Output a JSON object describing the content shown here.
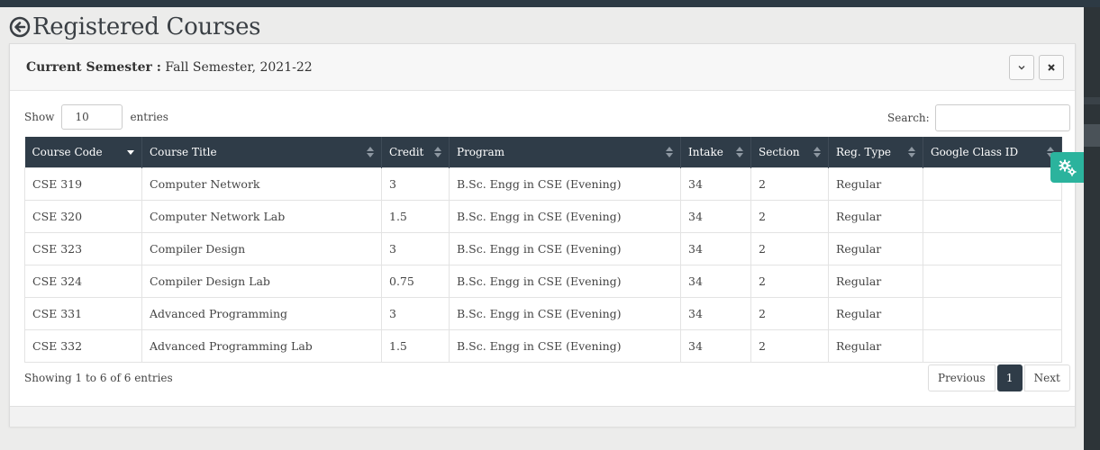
{
  "page": {
    "title": "Registered Courses"
  },
  "panel": {
    "semester_label": "Current Semester :",
    "semester_value": " Fall Semester, 2021-22"
  },
  "controls": {
    "show_label": "Show",
    "page_length": "10",
    "entries_label": "entries",
    "search_label": "Search:",
    "search_value": ""
  },
  "table": {
    "headers": [
      "Course Code",
      "Course Title",
      "Credit",
      "Program",
      "Intake",
      "Section",
      "Reg. Type",
      "Google Class ID"
    ],
    "rows": [
      [
        "CSE 319",
        "Computer Network",
        "3",
        "B.Sc. Engg in CSE (Evening)",
        "34",
        "2",
        "Regular",
        ""
      ],
      [
        "CSE 320",
        "Computer Network Lab",
        "1.5",
        "B.Sc. Engg in CSE (Evening)",
        "34",
        "2",
        "Regular",
        ""
      ],
      [
        "CSE 323",
        "Compiler Design",
        "3",
        "B.Sc. Engg in CSE (Evening)",
        "34",
        "2",
        "Regular",
        ""
      ],
      [
        "CSE 324",
        "Compiler Design Lab",
        "0.75",
        "B.Sc. Engg in CSE (Evening)",
        "34",
        "2",
        "Regular",
        ""
      ],
      [
        "CSE 331",
        "Advanced Programming",
        "3",
        "B.Sc. Engg in CSE (Evening)",
        "34",
        "2",
        "Regular",
        ""
      ],
      [
        "CSE 332",
        "Advanced Programming Lab",
        "1.5",
        "B.Sc. Engg in CSE (Evening)",
        "34",
        "2",
        "Regular",
        ""
      ]
    ]
  },
  "footer": {
    "info": "Showing 1 to 6 of 6 entries",
    "previous_label": "Previous",
    "current_page": "1",
    "next_label": "Next"
  },
  "colors": {
    "header_bg": "#2f3c48",
    "accent": "#2bb39d",
    "topbar": "#2d3a44"
  },
  "icons": {
    "back": "back-arrow-circle-icon",
    "collapse": "chevron-down-icon",
    "close": "close-icon",
    "sort": "sort-icon",
    "settings": "gears-icon"
  }
}
